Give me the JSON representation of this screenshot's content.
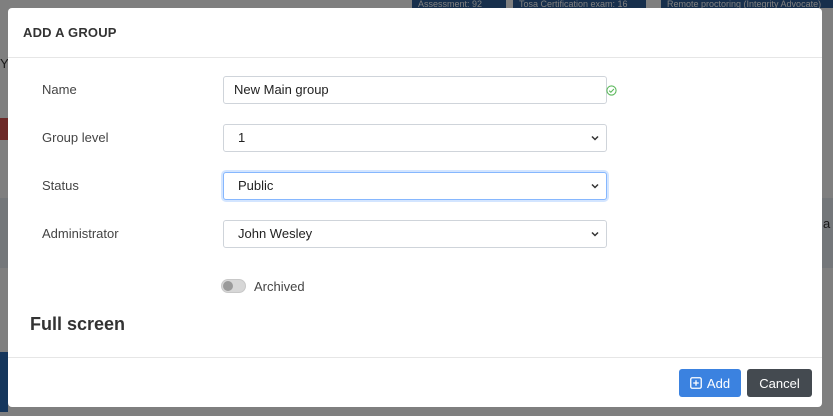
{
  "background": {
    "badges": [
      "Assessment: 92",
      "Tosa Certification exam: 16",
      "Remote proctoring (Integrity Advocate)"
    ],
    "left_fragment": "Yo",
    "right_fragment": "a"
  },
  "modal": {
    "title": "ADD A GROUP",
    "fields": {
      "name": {
        "label": "Name",
        "value": "New Main group",
        "valid": true
      },
      "group_level": {
        "label": "Group level",
        "value": "1"
      },
      "status": {
        "label": "Status",
        "value": "Public"
      },
      "administrator": {
        "label": "Administrator",
        "value": "John Wesley"
      }
    },
    "archived": {
      "label": "Archived",
      "checked": false
    },
    "section_title": "Full screen",
    "buttons": {
      "add": "Add",
      "cancel": "Cancel"
    }
  },
  "colors": {
    "primary": "#3b82e0",
    "secondary": "#444a50",
    "valid": "#5cb85c",
    "overlay": "rgba(0,0,0,0.5)"
  }
}
